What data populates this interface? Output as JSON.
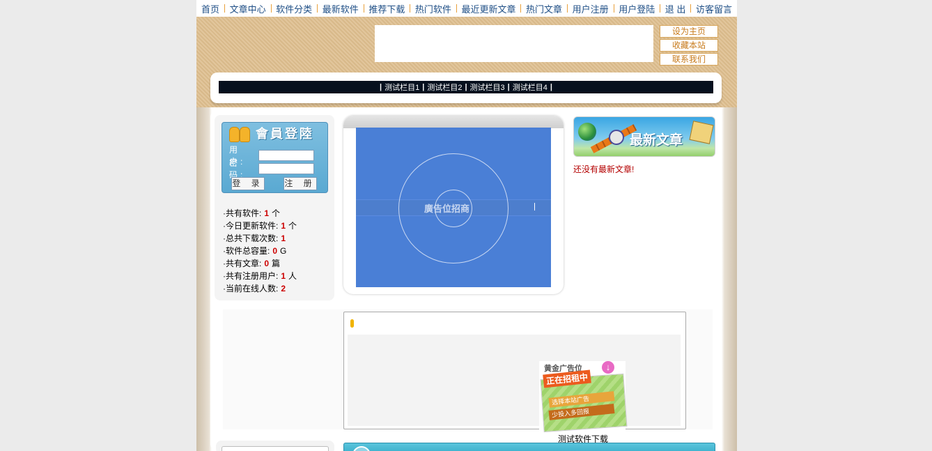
{
  "nav": [
    "首页",
    "文章中心",
    "软件分类",
    "最新软件",
    "推荐下载",
    "热门软件",
    "最近更新文章",
    "热门文章",
    "用户注册",
    "用户登陆",
    "退 出",
    "访客留言"
  ],
  "side_links": [
    "设为主页",
    "收藏本站",
    "联系我们"
  ],
  "columns": [
    "测试栏目1",
    "测试栏目2",
    "测试栏目3",
    "测试栏目4"
  ],
  "login": {
    "title": "會員登陸",
    "user_label": "用 户:",
    "pass_label": "密 码:",
    "user_value": "",
    "pass_value": "",
    "login_button": "登 录",
    "register_button": "注 册"
  },
  "stats": [
    {
      "label": "·共有软件:",
      "value": "1",
      "unit": "个"
    },
    {
      "label": "·今日更新软件:",
      "value": "1",
      "unit": "个"
    },
    {
      "label": "·总共下载次数:",
      "value": "1",
      "unit": ""
    },
    {
      "label": "·软件总容量:",
      "value": "0",
      "unit": "G"
    },
    {
      "label": "·共有文章:",
      "value": "0",
      "unit": "篇"
    },
    {
      "label": "·共有注册用户:",
      "value": "1",
      "unit": "人"
    },
    {
      "label": "·当前在线人数:",
      "value": "2",
      "unit": ""
    }
  ],
  "center_ad": {
    "text": "廣告位招商"
  },
  "latest": {
    "banner_title": "最新文章",
    "empty_text": "还没有最新文章!"
  },
  "gold_ad": {
    "title": "黄金广告位",
    "headline": "正在招租中",
    "line1": "选择本站广告",
    "line2": "少投入多回报"
  },
  "software": {
    "name": "测试软件下载"
  },
  "colors": {
    "nav_text": "#1f4f86",
    "nav_separator": "#e8a03b",
    "stat_number": "#cc0000",
    "notice_text": "#b40000",
    "ad_blue": "#4a7fd6"
  }
}
